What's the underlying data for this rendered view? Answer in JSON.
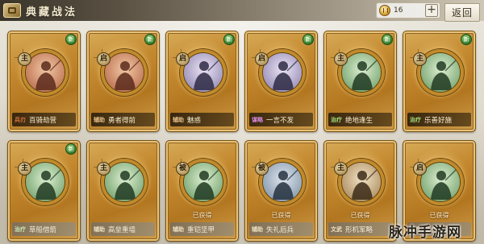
{
  "header": {
    "title": "典藏战法",
    "currency_value": "16",
    "add_label": "+",
    "back_label": "返回"
  },
  "cards": [
    {
      "category": "兵刃",
      "name": "百骑劫营",
      "type": "主",
      "owned": "",
      "new": true,
      "greyed": false,
      "category_color": "#e07a42",
      "portrait": "warm"
    },
    {
      "category": "辅助",
      "name": "勇者得前",
      "type": "启",
      "owned": "",
      "new": true,
      "greyed": false,
      "category_color": "#e8c38a",
      "portrait": "warm"
    },
    {
      "category": "辅助",
      "name": "魅惑",
      "type": "启",
      "owned": "",
      "new": true,
      "greyed": false,
      "category_color": "#e8c38a",
      "portrait": "violet"
    },
    {
      "category": "谋略",
      "name": "一言不发",
      "type": "启",
      "owned": "",
      "new": true,
      "greyed": false,
      "category_color": "#d98be0",
      "portrait": "violet"
    },
    {
      "category": "治疗",
      "name": "绝地逢生",
      "type": "主",
      "owned": "",
      "new": true,
      "greyed": false,
      "category_color": "#a6dd7a",
      "portrait": "green"
    },
    {
      "category": "治疗",
      "name": "乐善好施",
      "type": "主",
      "owned": "",
      "new": true,
      "greyed": false,
      "category_color": "#a6dd7a",
      "portrait": "green"
    },
    {
      "category": "治疗",
      "name": "草船借箭",
      "type": "主",
      "owned": "",
      "new": true,
      "greyed": true,
      "category_color": "#c9e6b4",
      "portrait": "green"
    },
    {
      "category": "辅助",
      "name": "高垒重墙",
      "type": "主",
      "owned": "",
      "new": false,
      "greyed": true,
      "category_color": "#f1e3c4",
      "portrait": "green"
    },
    {
      "category": "辅助",
      "name": "重铠坚甲",
      "type": "被",
      "owned": "已获得",
      "new": false,
      "greyed": true,
      "category_color": "#f1e3c4",
      "portrait": "green"
    },
    {
      "category": "辅助",
      "name": "失礼后兵",
      "type": "被",
      "owned": "已获得",
      "new": false,
      "greyed": true,
      "category_color": "#f1e3c4",
      "portrait": "slate"
    },
    {
      "category": "文武",
      "name": "形机军略",
      "type": "主",
      "owned": "已获得",
      "new": false,
      "greyed": true,
      "category_color": "#f1e3c4",
      "portrait": "sepia"
    },
    {
      "category": "治疗",
      "name": "草创之法",
      "type": "启",
      "owned": "已获得",
      "new": false,
      "greyed": true,
      "category_color": "#f1e3c4",
      "portrait": "green"
    }
  ],
  "new_badge_text": "新",
  "watermark": "脉冲手游网",
  "colors": {
    "topbar": "#4d4538",
    "card_gold": "#c4892f",
    "new_badge": "#2f7a2a"
  }
}
